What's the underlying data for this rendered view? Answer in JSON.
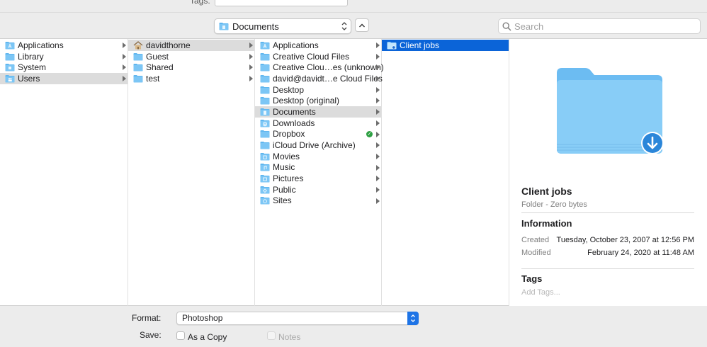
{
  "tags_bar": {
    "label": "Tags:"
  },
  "toolbar": {
    "location": "Documents",
    "search_placeholder": "Search"
  },
  "columns": [
    {
      "items": [
        {
          "label": "Applications",
          "icon": "app-folder-icon",
          "arrow": true,
          "selected": false
        },
        {
          "label": "Library",
          "icon": "folder-icon",
          "arrow": true,
          "selected": false
        },
        {
          "label": "System",
          "icon": "system-folder-icon",
          "arrow": true,
          "selected": false
        },
        {
          "label": "Users",
          "icon": "users-folder-icon",
          "arrow": true,
          "selected": "gray"
        }
      ]
    },
    {
      "items": [
        {
          "label": "davidthorne",
          "icon": "home-icon",
          "arrow": true,
          "selected": "gray"
        },
        {
          "label": "Guest",
          "icon": "folder-icon",
          "arrow": true,
          "selected": false
        },
        {
          "label": "Shared",
          "icon": "folder-icon",
          "arrow": true,
          "selected": false
        },
        {
          "label": "test",
          "icon": "folder-icon",
          "arrow": true,
          "selected": false
        }
      ]
    },
    {
      "items": [
        {
          "label": "Applications",
          "icon": "app-folder-icon",
          "arrow": true,
          "selected": false
        },
        {
          "label": "Creative Cloud Files",
          "icon": "folder-icon",
          "arrow": true,
          "selected": false
        },
        {
          "label": "Creative Clou…es (unknown)",
          "icon": "folder-icon",
          "arrow": true,
          "selected": false
        },
        {
          "label": "david@davidt…e Cloud Files",
          "icon": "folder-icon",
          "arrow": true,
          "selected": false
        },
        {
          "label": "Desktop",
          "icon": "folder-icon",
          "arrow": true,
          "selected": false
        },
        {
          "label": "Desktop (original)",
          "icon": "folder-icon",
          "arrow": true,
          "selected": false
        },
        {
          "label": "Documents",
          "icon": "documents-folder-icon",
          "arrow": true,
          "selected": "gray"
        },
        {
          "label": "Downloads",
          "icon": "downloads-folder-icon",
          "arrow": true,
          "selected": false
        },
        {
          "label": "Dropbox",
          "icon": "folder-icon",
          "arrow": true,
          "selected": false,
          "synced": true
        },
        {
          "label": "iCloud Drive (Archive)",
          "icon": "folder-icon",
          "arrow": true,
          "selected": false
        },
        {
          "label": "Movies",
          "icon": "movies-folder-icon",
          "arrow": true,
          "selected": false
        },
        {
          "label": "Music",
          "icon": "music-folder-icon",
          "arrow": true,
          "selected": false
        },
        {
          "label": "Pictures",
          "icon": "pictures-folder-icon",
          "arrow": true,
          "selected": false
        },
        {
          "label": "Public",
          "icon": "public-folder-icon",
          "arrow": true,
          "selected": false
        },
        {
          "label": "Sites",
          "icon": "sites-folder-icon",
          "arrow": true,
          "selected": false
        }
      ]
    },
    {
      "items": [
        {
          "label": "Client jobs",
          "icon": "dropbox-folder-icon",
          "arrow": false,
          "selected": "blue"
        }
      ]
    }
  ],
  "preview": {
    "name": "Client jobs",
    "kind": "Folder - Zero bytes",
    "info_title": "Information",
    "created_label": "Created",
    "created_value": "Tuesday, October 23, 2007 at 12:56 PM",
    "modified_label": "Modified",
    "modified_value": "February 24, 2020 at 11:48 AM",
    "tags_title": "Tags",
    "tags_placeholder": "Add Tags..."
  },
  "bottom": {
    "format_label": "Format:",
    "format_value": "Photoshop",
    "save_label": "Save:",
    "as_copy_label": "As a Copy",
    "notes_label": "Notes"
  },
  "colors": {
    "selection_blue": "#0b64d8",
    "selection_gray": "#dcdcdc",
    "folder_blue": "#5fb6ef"
  }
}
